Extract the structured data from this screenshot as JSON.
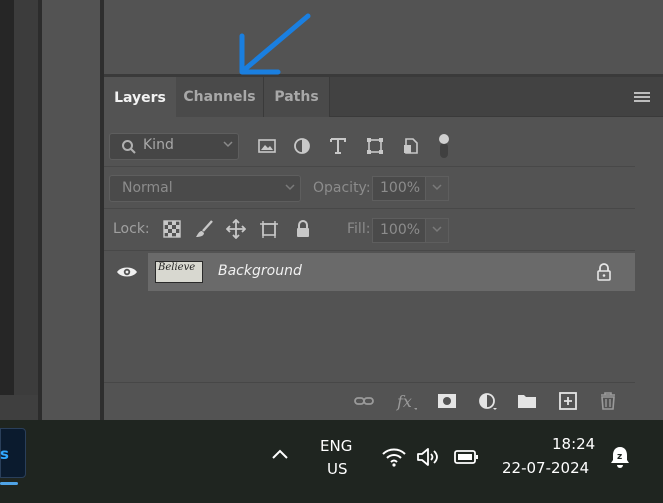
{
  "tabs": [
    {
      "label": "Layers",
      "active": true
    },
    {
      "label": "Channels",
      "active": false
    },
    {
      "label": "Paths",
      "active": false
    }
  ],
  "filter": {
    "kind_label": "Kind",
    "icons": [
      "image-filter-icon",
      "adjustment-filter-icon",
      "type-filter-icon",
      "shape-filter-icon",
      "smart-object-filter-icon",
      "filter-toggle-icon"
    ]
  },
  "blend": {
    "mode": "Normal",
    "opacity_label": "Opacity:",
    "opacity_value": "100%"
  },
  "lock": {
    "label": "Lock:",
    "icons": [
      "lock-transparent-pixels-icon",
      "lock-image-pixels-icon",
      "lock-position-icon",
      "artboard-nesting-icon",
      "lock-all-icon"
    ],
    "fill_label": "Fill:",
    "fill_value": "100%"
  },
  "layers": [
    {
      "name": "Background",
      "thumbnail_text": "Believe",
      "visible": true,
      "locked": true
    }
  ],
  "bottom_toolbar": [
    "link-layers-icon",
    "fx-icon",
    "add-mask-icon",
    "adjustment-layer-icon",
    "group-folder-icon",
    "new-layer-icon",
    "delete-icon"
  ],
  "taskbar": {
    "app_letter": "s",
    "lang_line1": "ENG",
    "lang_line2": "US",
    "time": "18:24",
    "date": "22-07-2024"
  },
  "colors": {
    "annotation_arrow": "#1a7fe0",
    "panel_bg": "#535353",
    "selected_layer_bg": "#6a6a6a"
  }
}
